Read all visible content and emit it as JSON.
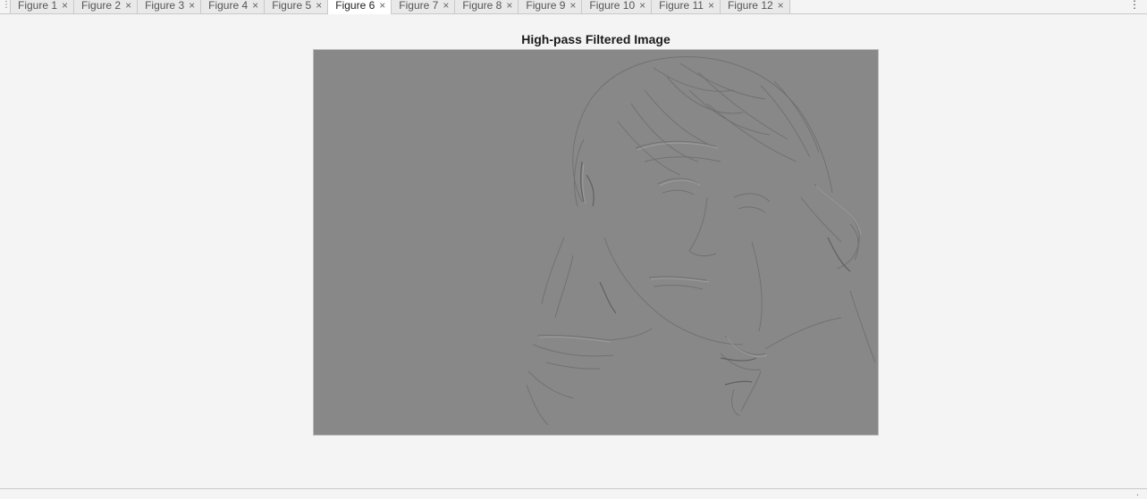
{
  "tabs": [
    {
      "label": "Figure 1",
      "active": false
    },
    {
      "label": "Figure 2",
      "active": false
    },
    {
      "label": "Figure 3",
      "active": false
    },
    {
      "label": "Figure 4",
      "active": false
    },
    {
      "label": "Figure 5",
      "active": false
    },
    {
      "label": "Figure 6",
      "active": true
    },
    {
      "label": "Figure 7",
      "active": false
    },
    {
      "label": "Figure 8",
      "active": false
    },
    {
      "label": "Figure 9",
      "active": false
    },
    {
      "label": "Figure 10",
      "active": false
    },
    {
      "label": "Figure 11",
      "active": false
    },
    {
      "label": "Figure 12",
      "active": false
    }
  ],
  "tab_close_glyph": "×",
  "figure": {
    "title": "High-pass Filtered Image"
  },
  "icons": {
    "grip": "grip-icon",
    "menu": "more-options-icon",
    "close": "close-icon"
  },
  "colors": {
    "background": "#f4f4f4",
    "image_gray": "#888888",
    "active_tab": "#ffffff",
    "inactive_tab": "#e9e9e9"
  }
}
